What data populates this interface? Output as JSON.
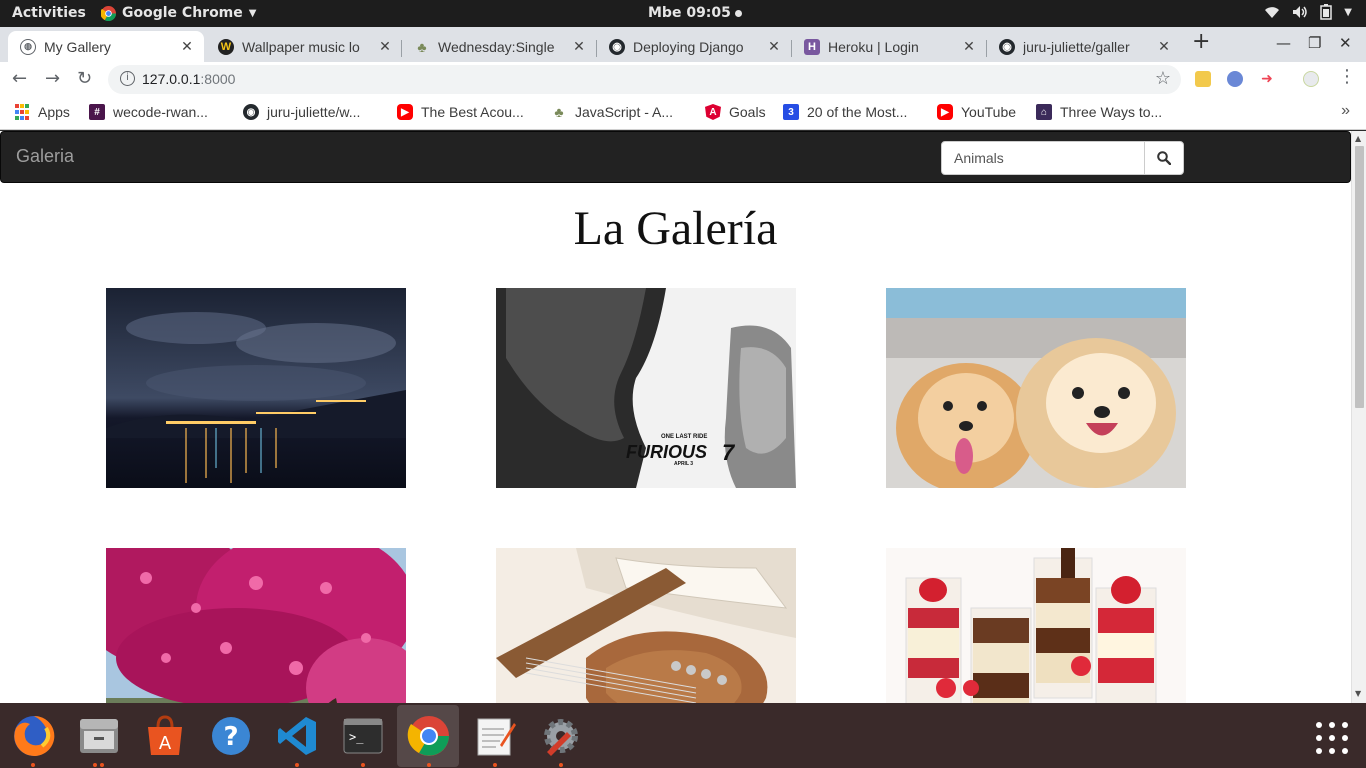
{
  "topbar": {
    "activities": "Activities",
    "app_name": "Google Chrome",
    "clock": "Mbe 09:05"
  },
  "tabs": [
    {
      "title": "My Gallery",
      "icon": "globe-icon",
      "active": true
    },
    {
      "title": "Wallpaper music lo",
      "icon": "wallpaper-w-icon",
      "active": false
    },
    {
      "title": "Wednesday:Single",
      "icon": "tree-icon",
      "active": false
    },
    {
      "title": "Deploying Django",
      "icon": "github-icon",
      "active": false
    },
    {
      "title": "Heroku | Login",
      "icon": "heroku-icon",
      "active": false
    },
    {
      "title": "juru-juliette/galler",
      "icon": "github-icon",
      "active": false
    }
  ],
  "omnibox": {
    "host": "127.0.0.1",
    "port": ":8000"
  },
  "bookmarks": [
    {
      "label": "Apps",
      "icon": "apps-grid-icon"
    },
    {
      "label": "wecode-rwan...",
      "icon": "slack-icon"
    },
    {
      "label": "juru-juliette/w...",
      "icon": "github-icon"
    },
    {
      "label": "The Best Acou...",
      "icon": "youtube-icon"
    },
    {
      "label": "JavaScript - A...",
      "icon": "tree-icon"
    },
    {
      "label": "Goals",
      "icon": "angular-icon"
    },
    {
      "label": "20 of the Most...",
      "icon": "css3-icon"
    },
    {
      "label": "YouTube",
      "icon": "youtube-icon"
    },
    {
      "label": "Three Ways to...",
      "icon": "heroku-icon"
    }
  ],
  "page": {
    "brand": "Galeria",
    "search_value": "Animals",
    "title": "La Galería",
    "images": [
      {
        "subject": "night-city-harbor"
      },
      {
        "subject": "furious-7-poster",
        "caption_top": "ONE LAST RIDE",
        "caption_main": "FURIOUS",
        "caption_num": "7",
        "caption_date": "APRIL 3"
      },
      {
        "subject": "pomeranian-dogs"
      },
      {
        "subject": "pink-blossom-tree"
      },
      {
        "subject": "bass-guitar-book"
      },
      {
        "subject": "dessert-cups"
      }
    ]
  },
  "colors": {
    "navbar": "#222222",
    "brand_text": "#9d9d9d",
    "dock": "#3a2a2a",
    "ubuntu_orange": "#e95420"
  }
}
